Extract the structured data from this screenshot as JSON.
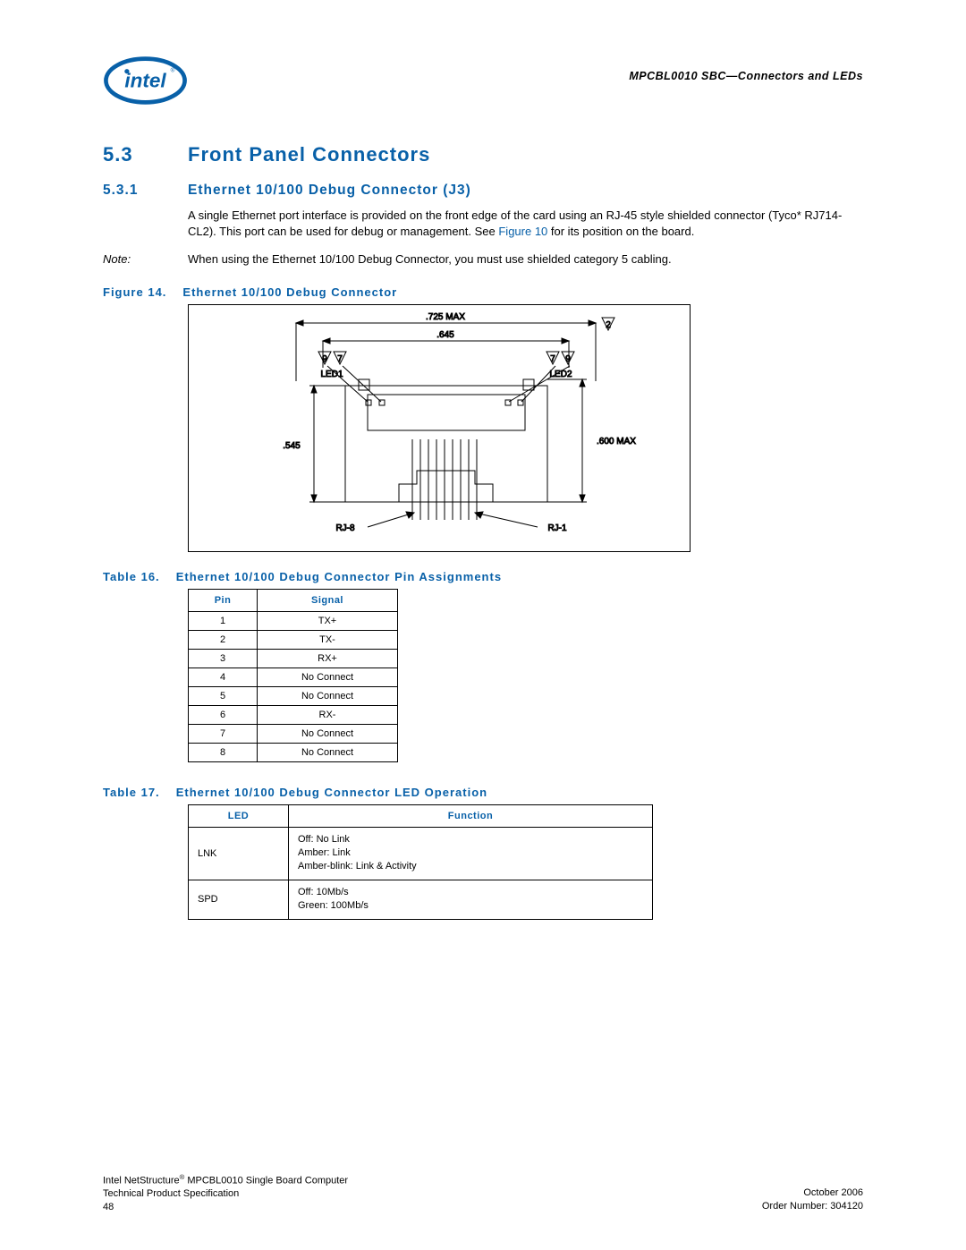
{
  "header": {
    "doc_header": "MPCBL0010 SBC—Connectors and LEDs"
  },
  "section": {
    "num": "5.3",
    "title": "Front Panel Connectors"
  },
  "subsection": {
    "num": "5.3.1",
    "title": "Ethernet 10/100 Debug Connector (J3)"
  },
  "body": {
    "para1_a": "A single Ethernet port interface is provided on the front edge of the card using an RJ-45 style shielded connector (Tyco* RJ714-CL2). This port can be used for debug or management. See ",
    "para1_link": "Figure 10",
    "para1_b": " for its position on the board.",
    "note_label": "Note:",
    "note_text": "When using the Ethernet 10/100 Debug Connector, you must use shielded category 5 cabling."
  },
  "figure14": {
    "num": "Figure 14.",
    "title": "Ethernet 10/100 Debug Connector",
    "labels": {
      "top_dim": ".725 MAX",
      "mid_dim": ".645",
      "left_dim": ".545",
      "right_dim": ".600 MAX",
      "led1": "LED1",
      "led2": "LED2",
      "rj8": "RJ-8",
      "rj1": "RJ-1",
      "tri_9": "9",
      "tri_7": "7",
      "tri_2": "2"
    }
  },
  "table16": {
    "num": "Table 16.",
    "title": "Ethernet 10/100 Debug Connector Pin Assignments",
    "headers": {
      "col1": "Pin",
      "col2": "Signal"
    },
    "rows": [
      {
        "pin": "1",
        "signal": "TX+"
      },
      {
        "pin": "2",
        "signal": "TX-"
      },
      {
        "pin": "3",
        "signal": "RX+"
      },
      {
        "pin": "4",
        "signal": "No Connect"
      },
      {
        "pin": "5",
        "signal": "No Connect"
      },
      {
        "pin": "6",
        "signal": "RX-"
      },
      {
        "pin": "7",
        "signal": "No Connect"
      },
      {
        "pin": "8",
        "signal": "No Connect"
      }
    ]
  },
  "table17": {
    "num": "Table 17.",
    "title": "Ethernet 10/100 Debug Connector LED Operation",
    "headers": {
      "col1": "LED",
      "col2": "Function"
    },
    "rows": [
      {
        "led": "LNK",
        "func": "Off: No Link\nAmber: Link\nAmber-blink: Link & Activity"
      },
      {
        "led": "SPD",
        "func": "Off: 10Mb/s\nGreen: 100Mb/s"
      }
    ]
  },
  "footer": {
    "product": "Intel NetStructure",
    "product_suffix": " MPCBL0010 Single Board Computer",
    "spec": "Technical Product Specification",
    "page": "48",
    "date": "October 2006",
    "order": "Order Number: 304120"
  }
}
